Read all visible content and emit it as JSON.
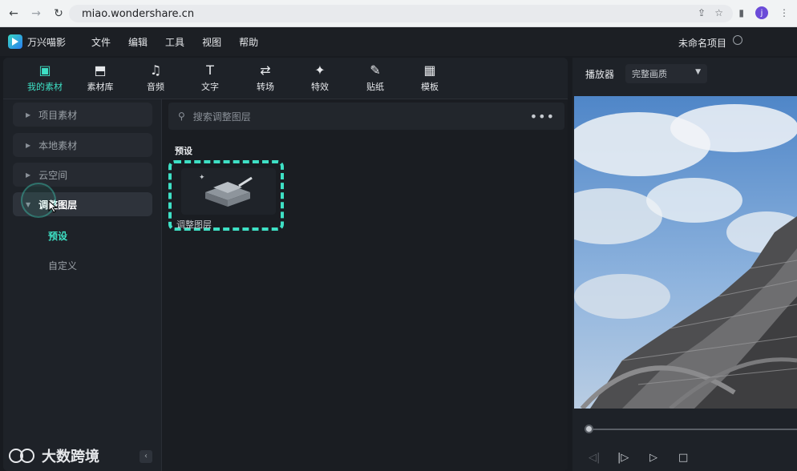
{
  "browser": {
    "url": "miao.wondershare.cn",
    "avatar": "j"
  },
  "app": {
    "name": "万兴喵影",
    "project_name": "未命名项目"
  },
  "menu": [
    "文件",
    "编辑",
    "工具",
    "视图",
    "帮助"
  ],
  "toolbar": [
    {
      "label": "我的素材",
      "icon": "my-media-icon",
      "glyph": "▣",
      "active": true
    },
    {
      "label": "素材库",
      "icon": "stock-media-icon",
      "glyph": "⬒",
      "active": false
    },
    {
      "label": "音频",
      "icon": "music-note-icon",
      "glyph": "♫",
      "active": false
    },
    {
      "label": "文字",
      "icon": "text-icon",
      "glyph": "T",
      "active": false
    },
    {
      "label": "转场",
      "icon": "transition-icon",
      "glyph": "⇄",
      "active": false
    },
    {
      "label": "特效",
      "icon": "effects-icon",
      "glyph": "✦",
      "active": false
    },
    {
      "label": "贴纸",
      "icon": "sticker-icon",
      "glyph": "✎",
      "active": false
    },
    {
      "label": "模板",
      "icon": "template-icon",
      "glyph": "▦",
      "active": false
    }
  ],
  "sidebar": {
    "items": [
      {
        "label": "项目素材"
      },
      {
        "label": "本地素材"
      },
      {
        "label": "云空间"
      },
      {
        "label": "调整图层"
      }
    ],
    "subitems": [
      {
        "label": "预设"
      },
      {
        "label": "自定义"
      }
    ]
  },
  "content": {
    "search_placeholder": "搜索调整图层",
    "section_title": "预设",
    "asset_label": "调整图层"
  },
  "player": {
    "title": "播放器",
    "quality": "完整画质"
  },
  "watermark": "大数跨境",
  "colors": {
    "accent": "#3ee0c5",
    "background": "#181b20",
    "panel": "#1e2228"
  }
}
